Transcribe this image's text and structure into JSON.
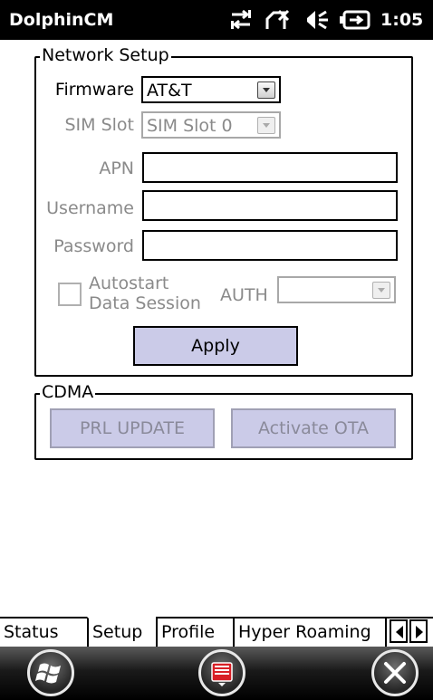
{
  "title_bar": {
    "app_title": "DolphinCM",
    "time": "1:05",
    "status_icons": [
      "data-connection-icon",
      "signal-icon",
      "volume-icon",
      "battery-icon"
    ]
  },
  "network_setup": {
    "legend": "Network Setup",
    "firmware": {
      "label": "Firmware",
      "value": "AT&T"
    },
    "sim_slot": {
      "label": "SIM Slot",
      "value": "SIM Slot 0"
    },
    "apn": {
      "label": "APN",
      "value": ""
    },
    "username": {
      "label": "Username",
      "value": ""
    },
    "password": {
      "label": "Password",
      "value": ""
    },
    "autostart": {
      "label_line1": "Autostart",
      "label_line2": "Data Session",
      "checked": false
    },
    "auth": {
      "label": "AUTH",
      "value": ""
    },
    "apply_label": "Apply"
  },
  "cdma": {
    "legend": "CDMA",
    "prl_update_label": "PRL UPDATE",
    "activate_ota_label": "Activate OTA"
  },
  "tabs": [
    {
      "label": "Status",
      "active": false
    },
    {
      "label": "Setup",
      "active": true
    },
    {
      "label": "Profile",
      "active": false
    },
    {
      "label": "Hyper Roaming",
      "active": false
    }
  ],
  "bottom_bar": {
    "start_icon": "windows-start-icon",
    "keyboard_icon": "keyboard-icon",
    "close_icon": "close-icon"
  },
  "colors": {
    "titlebar_bg": "#000000",
    "button_bg": "#cbcbe8",
    "disabled_text": "#8a8a8a",
    "keyboard_red": "#d81f26"
  }
}
